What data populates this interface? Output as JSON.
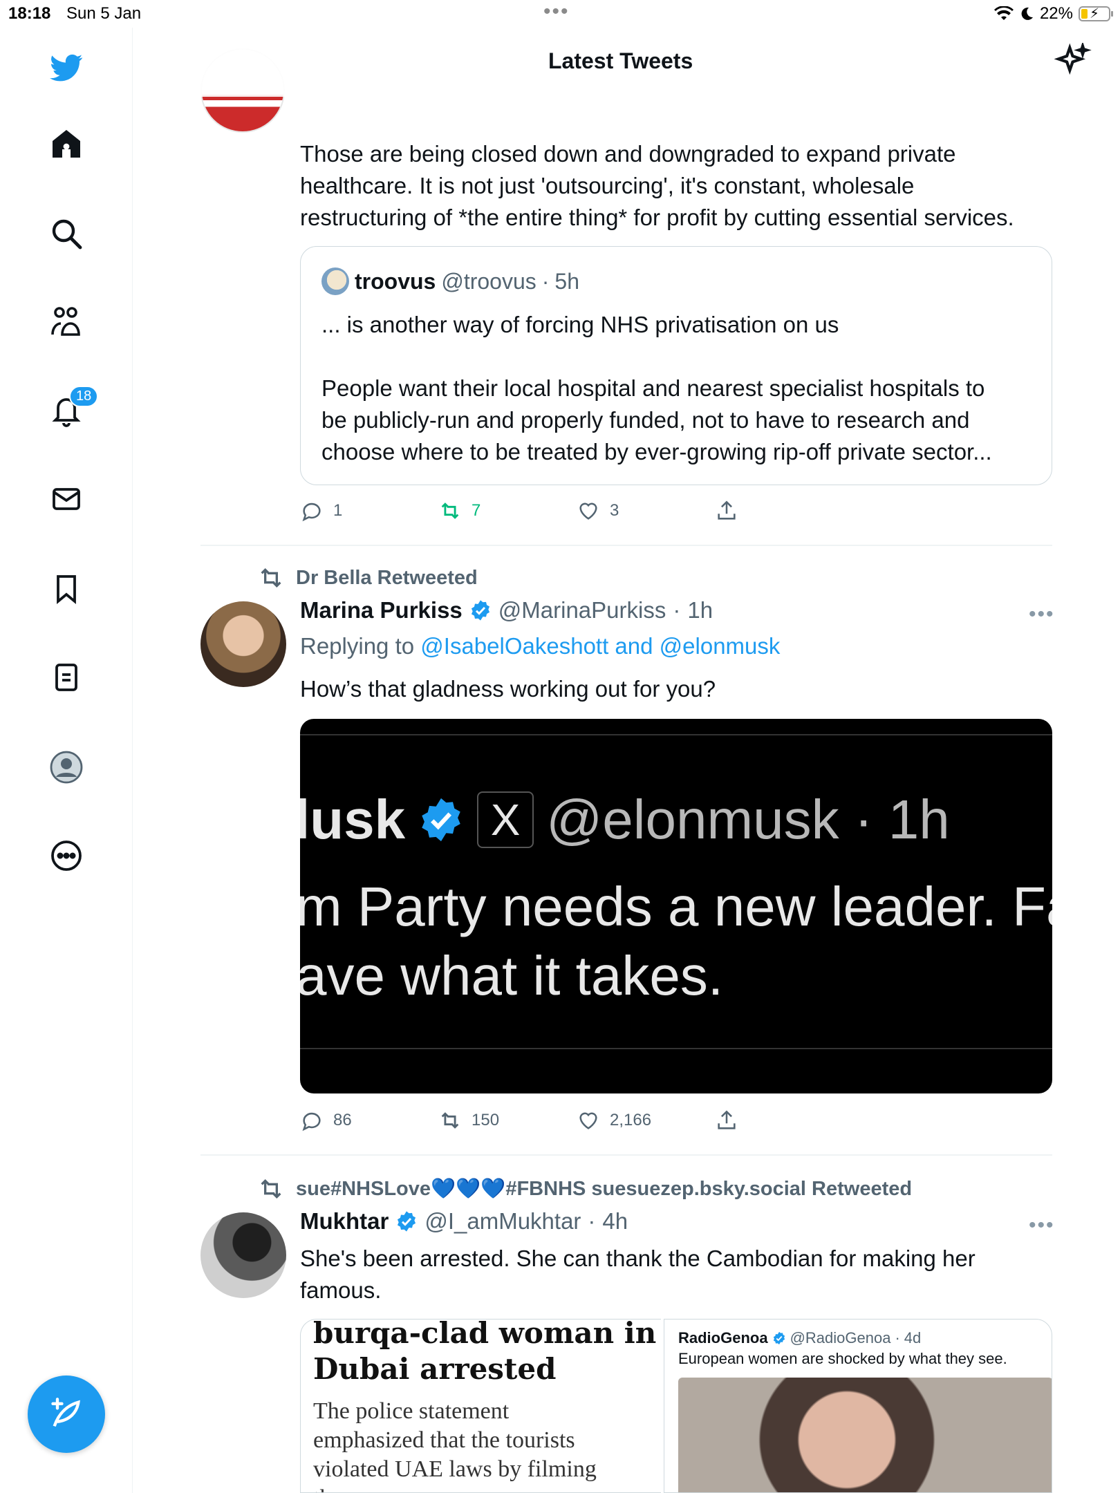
{
  "status_bar": {
    "time": "18:18",
    "date": "Sun 5 Jan",
    "battery": "22%",
    "battery_level": 0.22
  },
  "header": {
    "title": "Latest Tweets"
  },
  "sidebar": {
    "notifications_badge": "18",
    "items": [
      "twitter-logo",
      "home",
      "search",
      "communities",
      "notifications",
      "messages",
      "bookmarks",
      "lists",
      "profile",
      "more"
    ]
  },
  "tweet1": {
    "text": "Those are being closed down and downgraded to expand private\nhealthcare. It is not just 'outsourcing', it's constant, wholesale\nrestructuring of *the entire thing* for profit by cutting essential services.",
    "quote": {
      "name": "troovus",
      "handle": "@troovus",
      "time": "5h",
      "body": "... is another way of forcing NHS privatisation on us\n\nPeople want their local hospital and nearest specialist hospitals to\nbe publicly-run and properly funded, not to have to research and\nchoose where to be treated by ever-growing rip-off private sector..."
    },
    "replies": "1",
    "retweets": "7",
    "likes": "3"
  },
  "tweet2": {
    "retweeted_by": "Dr Bella Retweeted",
    "name": "Marina Purkiss",
    "handle": "@MarinaPurkiss",
    "time": "1h",
    "replying_prefix": "Replying to",
    "replying_to": "@IsabelOakeshott and @elonmusk",
    "text": "How’s that gladness working out for you?",
    "media": {
      "name_fragment": "lusk",
      "x_mark": "X",
      "handle_time": "@elonmusk · 1h",
      "line1": "m Party needs a new leader. Fara",
      "line2": "ave what it takes."
    },
    "replies": "86",
    "retweets": "150",
    "likes": "2,166"
  },
  "tweet3": {
    "retweeted_by": "sue#NHSLove💙💙💙#FBNHS suesuezep.bsky.social Retweeted",
    "name": "Mukhtar",
    "handle": "@I_amMukhtar",
    "time": "4h",
    "text": "She's been arrested. She can thank the Cambodian for making her\nfamous.",
    "media_left": {
      "headline": "burqa-clad woman in\nDubai arrested",
      "body": "The police statement\nemphasized that the tourists\nviolated UAE laws by filming\nthe woman"
    },
    "media_right": {
      "name": "RadioGenoa",
      "handle": "@RadioGenoa",
      "time": "4d",
      "text": "European women are shocked by what they see."
    }
  },
  "colors": {
    "accent": "#1d9bf0",
    "retweet_green": "#00ba7c",
    "muted": "#536471",
    "border": "#cfd9de"
  }
}
